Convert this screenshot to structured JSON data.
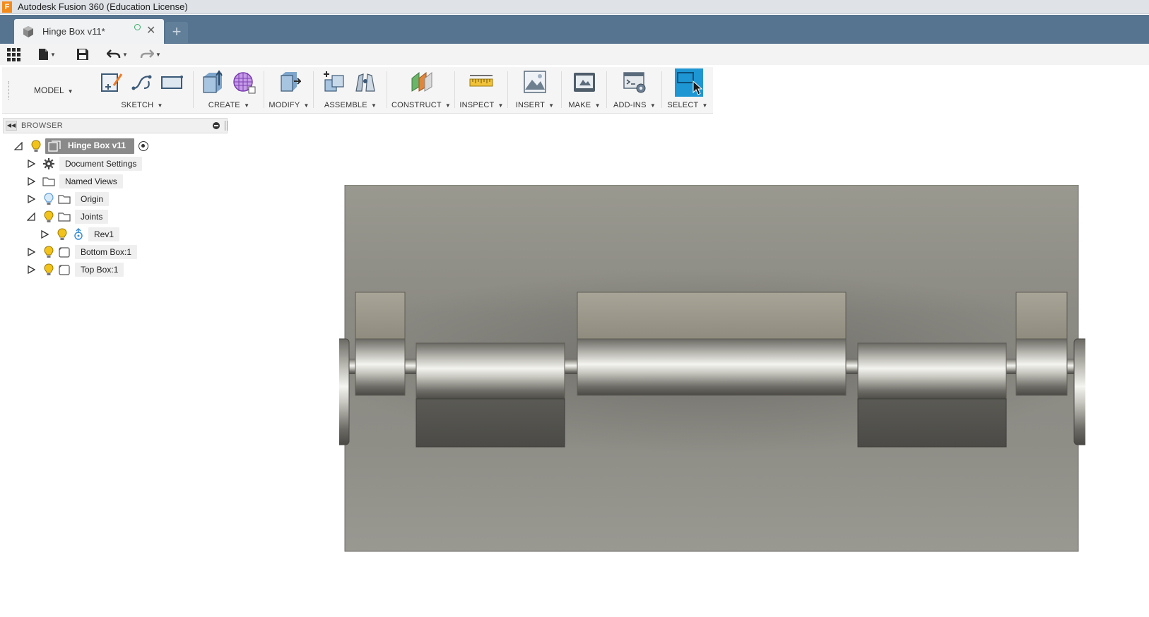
{
  "window": {
    "title": "Autodesk Fusion 360 (Education License)",
    "logo_letter": "F"
  },
  "tabs": {
    "active": {
      "label": "Hinge Box v11*",
      "close": "✕"
    },
    "new_tab": "+"
  },
  "quick_access": {
    "icons": [
      "apps-grid-icon",
      "file-icon",
      "save-icon",
      "undo-icon",
      "redo-icon"
    ]
  },
  "toolbar": {
    "workspace": "MODEL",
    "groups": [
      {
        "id": "sketch",
        "label": "SKETCH"
      },
      {
        "id": "create",
        "label": "CREATE"
      },
      {
        "id": "modify",
        "label": "MODIFY"
      },
      {
        "id": "assemble",
        "label": "ASSEMBLE"
      },
      {
        "id": "construct",
        "label": "CONSTRUCT"
      },
      {
        "id": "inspect",
        "label": "INSPECT"
      },
      {
        "id": "insert",
        "label": "INSERT"
      },
      {
        "id": "make",
        "label": "MAKE"
      },
      {
        "id": "addins",
        "label": "ADD-INS"
      },
      {
        "id": "select",
        "label": "SELECT"
      }
    ],
    "caret": "▼",
    "accent": "#1e96d3"
  },
  "browser": {
    "title": "BROWSER",
    "tree": [
      {
        "label": "Hinge Box v11"
      },
      {
        "label": "Document Settings"
      },
      {
        "label": "Named Views"
      },
      {
        "label": "Origin"
      },
      {
        "label": "Joints"
      },
      {
        "label": "Rev1"
      },
      {
        "label": "Bottom Box:1"
      },
      {
        "label": "Top Box:1"
      }
    ]
  },
  "colors": {
    "tabbar": "#56738f",
    "bulb_on": "#f2c31b",
    "bulb_off": "#5e9fd8",
    "model_bg": "#8f8e86"
  }
}
